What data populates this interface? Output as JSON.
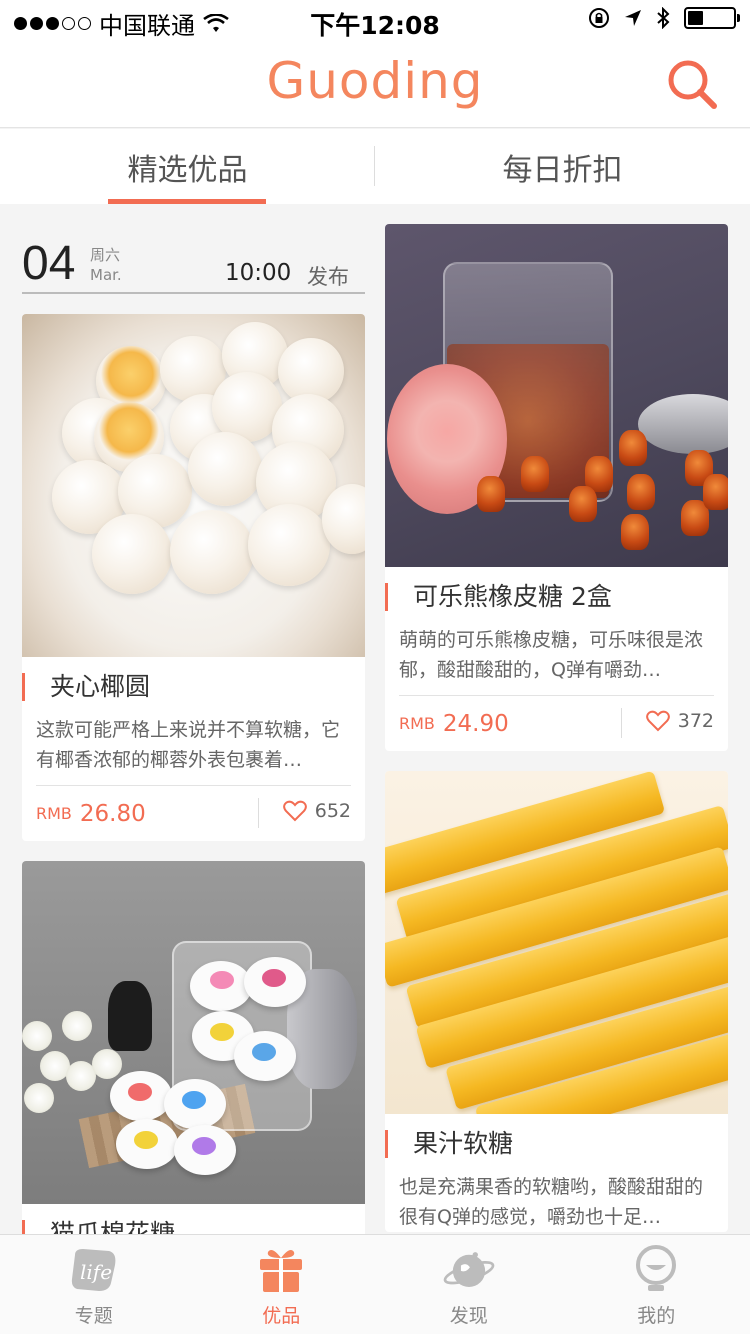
{
  "status_bar": {
    "carrier": "中国联通",
    "time": "下午12:08"
  },
  "header": {
    "logo": "Guoding",
    "accent_color": "#f4865e",
    "search_icon": "search-icon"
  },
  "tabs": [
    {
      "label": "精选优品",
      "active": true
    },
    {
      "label": "每日折扣",
      "active": false
    }
  ],
  "date_block": {
    "day": "04",
    "weekday": "周六",
    "month": "Mar.",
    "time": "10:00",
    "publish": "发布"
  },
  "cards": {
    "coconut": {
      "title": "夹心椰圆",
      "desc": "这款可能严格上来说并不算软糖，它有椰香浓郁的椰蓉外表包裹着…",
      "currency": "RMB",
      "price": "26.80",
      "likes": "652"
    },
    "bear": {
      "title": "可乐熊橡皮糖 2盒",
      "desc": "萌萌的可乐熊橡皮糖，可乐味很是浓郁，酸甜酸甜的，Q弹有嚼劲…",
      "currency": "RMB",
      "price": "24.90",
      "likes": "372"
    },
    "cat": {
      "title": "猫爪棉花糖"
    },
    "fruit": {
      "title": "果汁软糖",
      "desc": "也是充满果香的软糖哟，酸酸甜甜的很有Q弹的感觉，嚼劲也十足…"
    }
  },
  "tabbar": [
    {
      "label": "专题",
      "icon": "life-icon",
      "active": false
    },
    {
      "label": "优品",
      "icon": "gift-icon",
      "active": true
    },
    {
      "label": "发现",
      "icon": "planet-icon",
      "active": false
    },
    {
      "label": "我的",
      "icon": "profile-icon",
      "active": false
    }
  ]
}
